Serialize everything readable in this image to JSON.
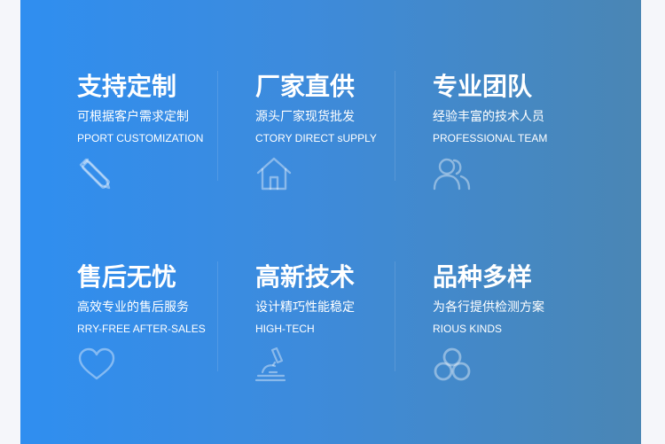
{
  "features": [
    {
      "title": "支持定制",
      "subtitle": "可根据客户需求定制",
      "english": "PPORT CUSTOMIZATION",
      "icon": "pencil-ruler-icon"
    },
    {
      "title": "厂家直供",
      "subtitle": "源头厂家现货批发",
      "english": "CTORY DIRECT sUPPLY",
      "icon": "house-icon"
    },
    {
      "title": "专业团队",
      "subtitle": "经验丰富的技术人员",
      "english": "PROFESSIONAL TEAM",
      "icon": "users-icon"
    },
    {
      "title": "售后无忧",
      "subtitle": "高效专业的售后服务",
      "english": "RRY-FREE AFTER-SALES",
      "icon": "heart-icon"
    },
    {
      "title": "高新技术",
      "subtitle": "设计精巧性能稳定",
      "english": "HIGH-TECH",
      "icon": "microscope-icon"
    },
    {
      "title": "品种多样",
      "subtitle": "为各行提供检测方案",
      "english": "RIOUS KINDS",
      "icon": "three-circles-icon"
    }
  ]
}
